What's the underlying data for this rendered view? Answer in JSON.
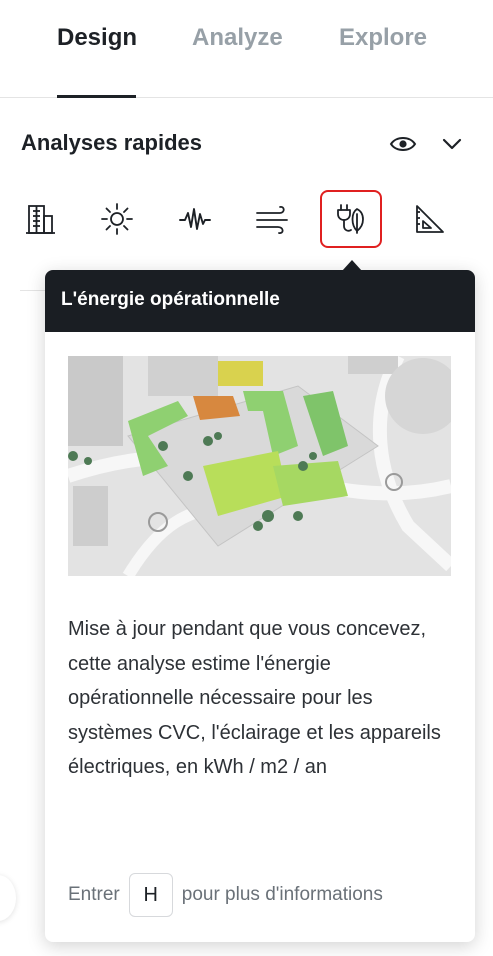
{
  "tabs": [
    {
      "label": "Design",
      "active": true
    },
    {
      "label": "Analyze",
      "active": false
    },
    {
      "label": "Explore",
      "active": false
    }
  ],
  "quick_analyses": {
    "title": "Analyses rapides",
    "toggle_icon": "eye-icon",
    "collapse_icon": "chevron-down-icon",
    "tools": [
      {
        "icon": "building-icon",
        "selected": false
      },
      {
        "icon": "sun-icon",
        "selected": false
      },
      {
        "icon": "sound-wave-icon",
        "selected": false
      },
      {
        "icon": "wind-icon",
        "selected": false
      },
      {
        "icon": "plug-leaf-icon",
        "selected": true
      },
      {
        "icon": "set-square-icon",
        "selected": false
      }
    ]
  },
  "tooltip": {
    "title": "L'énergie opérationnelle",
    "image_alt": "aerial-3d-site-model",
    "description": "Mise à jour pendant que vous concevez, cette analyse estime l'énergie opérationnelle nécessaire pour les systèmes CVC, l'éclairage et les appareils électriques, en kWh / m2 / an",
    "footer_prefix": "Entrer",
    "footer_key": "H",
    "footer_suffix": "pour plus d'informations"
  },
  "colors": {
    "active_tab": "#1d2126",
    "inactive_tab": "#97a0a7",
    "tooltip_header": "#1a1e23",
    "highlight": "#e02020"
  }
}
